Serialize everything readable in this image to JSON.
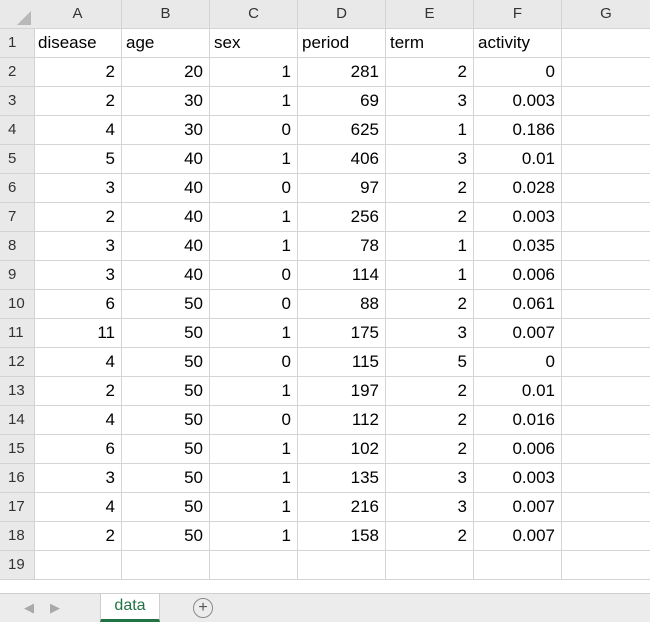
{
  "columns": [
    "A",
    "B",
    "C",
    "D",
    "E",
    "F",
    "G"
  ],
  "headers": [
    "disease",
    "age",
    "sex",
    "period",
    "term",
    "activity"
  ],
  "rows": [
    [
      "2",
      "20",
      "1",
      "281",
      "2",
      "0"
    ],
    [
      "2",
      "30",
      "1",
      "69",
      "3",
      "0.003"
    ],
    [
      "4",
      "30",
      "0",
      "625",
      "1",
      "0.186"
    ],
    [
      "5",
      "40",
      "1",
      "406",
      "3",
      "0.01"
    ],
    [
      "3",
      "40",
      "0",
      "97",
      "2",
      "0.028"
    ],
    [
      "2",
      "40",
      "1",
      "256",
      "2",
      "0.003"
    ],
    [
      "3",
      "40",
      "1",
      "78",
      "1",
      "0.035"
    ],
    [
      "3",
      "40",
      "0",
      "114",
      "1",
      "0.006"
    ],
    [
      "6",
      "50",
      "0",
      "88",
      "2",
      "0.061"
    ],
    [
      "11",
      "50",
      "1",
      "175",
      "3",
      "0.007"
    ],
    [
      "4",
      "50",
      "0",
      "115",
      "5",
      "0"
    ],
    [
      "2",
      "50",
      "1",
      "197",
      "2",
      "0.01"
    ],
    [
      "4",
      "50",
      "0",
      "112",
      "2",
      "0.016"
    ],
    [
      "6",
      "50",
      "1",
      "102",
      "2",
      "0.006"
    ],
    [
      "3",
      "50",
      "1",
      "135",
      "3",
      "0.003"
    ],
    [
      "4",
      "50",
      "1",
      "216",
      "3",
      "0.007"
    ],
    [
      "2",
      "50",
      "1",
      "158",
      "2",
      "0.007"
    ]
  ],
  "row_numbers": [
    "1",
    "2",
    "3",
    "4",
    "5",
    "6",
    "7",
    "8",
    "9",
    "10",
    "11",
    "12",
    "13",
    "14",
    "15",
    "16",
    "17",
    "18",
    "19"
  ],
  "sheet_tab": {
    "label": "data",
    "active_color": "#217346"
  },
  "nav": {
    "prev": "◀",
    "next": "▶",
    "add": "+"
  }
}
